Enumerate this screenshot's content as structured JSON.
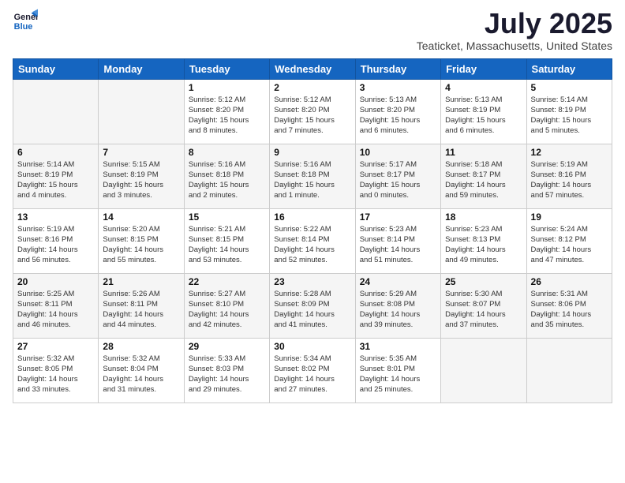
{
  "logo": {
    "line1": "General",
    "line2": "Blue"
  },
  "title": "July 2025",
  "location": "Teaticket, Massachusetts, United States",
  "days_of_week": [
    "Sunday",
    "Monday",
    "Tuesday",
    "Wednesday",
    "Thursday",
    "Friday",
    "Saturday"
  ],
  "weeks": [
    [
      {
        "day": "",
        "info": ""
      },
      {
        "day": "",
        "info": ""
      },
      {
        "day": "1",
        "info": "Sunrise: 5:12 AM\nSunset: 8:20 PM\nDaylight: 15 hours\nand 8 minutes."
      },
      {
        "day": "2",
        "info": "Sunrise: 5:12 AM\nSunset: 8:20 PM\nDaylight: 15 hours\nand 7 minutes."
      },
      {
        "day": "3",
        "info": "Sunrise: 5:13 AM\nSunset: 8:20 PM\nDaylight: 15 hours\nand 6 minutes."
      },
      {
        "day": "4",
        "info": "Sunrise: 5:13 AM\nSunset: 8:19 PM\nDaylight: 15 hours\nand 6 minutes."
      },
      {
        "day": "5",
        "info": "Sunrise: 5:14 AM\nSunset: 8:19 PM\nDaylight: 15 hours\nand 5 minutes."
      }
    ],
    [
      {
        "day": "6",
        "info": "Sunrise: 5:14 AM\nSunset: 8:19 PM\nDaylight: 15 hours\nand 4 minutes."
      },
      {
        "day": "7",
        "info": "Sunrise: 5:15 AM\nSunset: 8:19 PM\nDaylight: 15 hours\nand 3 minutes."
      },
      {
        "day": "8",
        "info": "Sunrise: 5:16 AM\nSunset: 8:18 PM\nDaylight: 15 hours\nand 2 minutes."
      },
      {
        "day": "9",
        "info": "Sunrise: 5:16 AM\nSunset: 8:18 PM\nDaylight: 15 hours\nand 1 minute."
      },
      {
        "day": "10",
        "info": "Sunrise: 5:17 AM\nSunset: 8:17 PM\nDaylight: 15 hours\nand 0 minutes."
      },
      {
        "day": "11",
        "info": "Sunrise: 5:18 AM\nSunset: 8:17 PM\nDaylight: 14 hours\nand 59 minutes."
      },
      {
        "day": "12",
        "info": "Sunrise: 5:19 AM\nSunset: 8:16 PM\nDaylight: 14 hours\nand 57 minutes."
      }
    ],
    [
      {
        "day": "13",
        "info": "Sunrise: 5:19 AM\nSunset: 8:16 PM\nDaylight: 14 hours\nand 56 minutes."
      },
      {
        "day": "14",
        "info": "Sunrise: 5:20 AM\nSunset: 8:15 PM\nDaylight: 14 hours\nand 55 minutes."
      },
      {
        "day": "15",
        "info": "Sunrise: 5:21 AM\nSunset: 8:15 PM\nDaylight: 14 hours\nand 53 minutes."
      },
      {
        "day": "16",
        "info": "Sunrise: 5:22 AM\nSunset: 8:14 PM\nDaylight: 14 hours\nand 52 minutes."
      },
      {
        "day": "17",
        "info": "Sunrise: 5:23 AM\nSunset: 8:14 PM\nDaylight: 14 hours\nand 51 minutes."
      },
      {
        "day": "18",
        "info": "Sunrise: 5:23 AM\nSunset: 8:13 PM\nDaylight: 14 hours\nand 49 minutes."
      },
      {
        "day": "19",
        "info": "Sunrise: 5:24 AM\nSunset: 8:12 PM\nDaylight: 14 hours\nand 47 minutes."
      }
    ],
    [
      {
        "day": "20",
        "info": "Sunrise: 5:25 AM\nSunset: 8:11 PM\nDaylight: 14 hours\nand 46 minutes."
      },
      {
        "day": "21",
        "info": "Sunrise: 5:26 AM\nSunset: 8:11 PM\nDaylight: 14 hours\nand 44 minutes."
      },
      {
        "day": "22",
        "info": "Sunrise: 5:27 AM\nSunset: 8:10 PM\nDaylight: 14 hours\nand 42 minutes."
      },
      {
        "day": "23",
        "info": "Sunrise: 5:28 AM\nSunset: 8:09 PM\nDaylight: 14 hours\nand 41 minutes."
      },
      {
        "day": "24",
        "info": "Sunrise: 5:29 AM\nSunset: 8:08 PM\nDaylight: 14 hours\nand 39 minutes."
      },
      {
        "day": "25",
        "info": "Sunrise: 5:30 AM\nSunset: 8:07 PM\nDaylight: 14 hours\nand 37 minutes."
      },
      {
        "day": "26",
        "info": "Sunrise: 5:31 AM\nSunset: 8:06 PM\nDaylight: 14 hours\nand 35 minutes."
      }
    ],
    [
      {
        "day": "27",
        "info": "Sunrise: 5:32 AM\nSunset: 8:05 PM\nDaylight: 14 hours\nand 33 minutes."
      },
      {
        "day": "28",
        "info": "Sunrise: 5:32 AM\nSunset: 8:04 PM\nDaylight: 14 hours\nand 31 minutes."
      },
      {
        "day": "29",
        "info": "Sunrise: 5:33 AM\nSunset: 8:03 PM\nDaylight: 14 hours\nand 29 minutes."
      },
      {
        "day": "30",
        "info": "Sunrise: 5:34 AM\nSunset: 8:02 PM\nDaylight: 14 hours\nand 27 minutes."
      },
      {
        "day": "31",
        "info": "Sunrise: 5:35 AM\nSunset: 8:01 PM\nDaylight: 14 hours\nand 25 minutes."
      },
      {
        "day": "",
        "info": ""
      },
      {
        "day": "",
        "info": ""
      }
    ]
  ]
}
